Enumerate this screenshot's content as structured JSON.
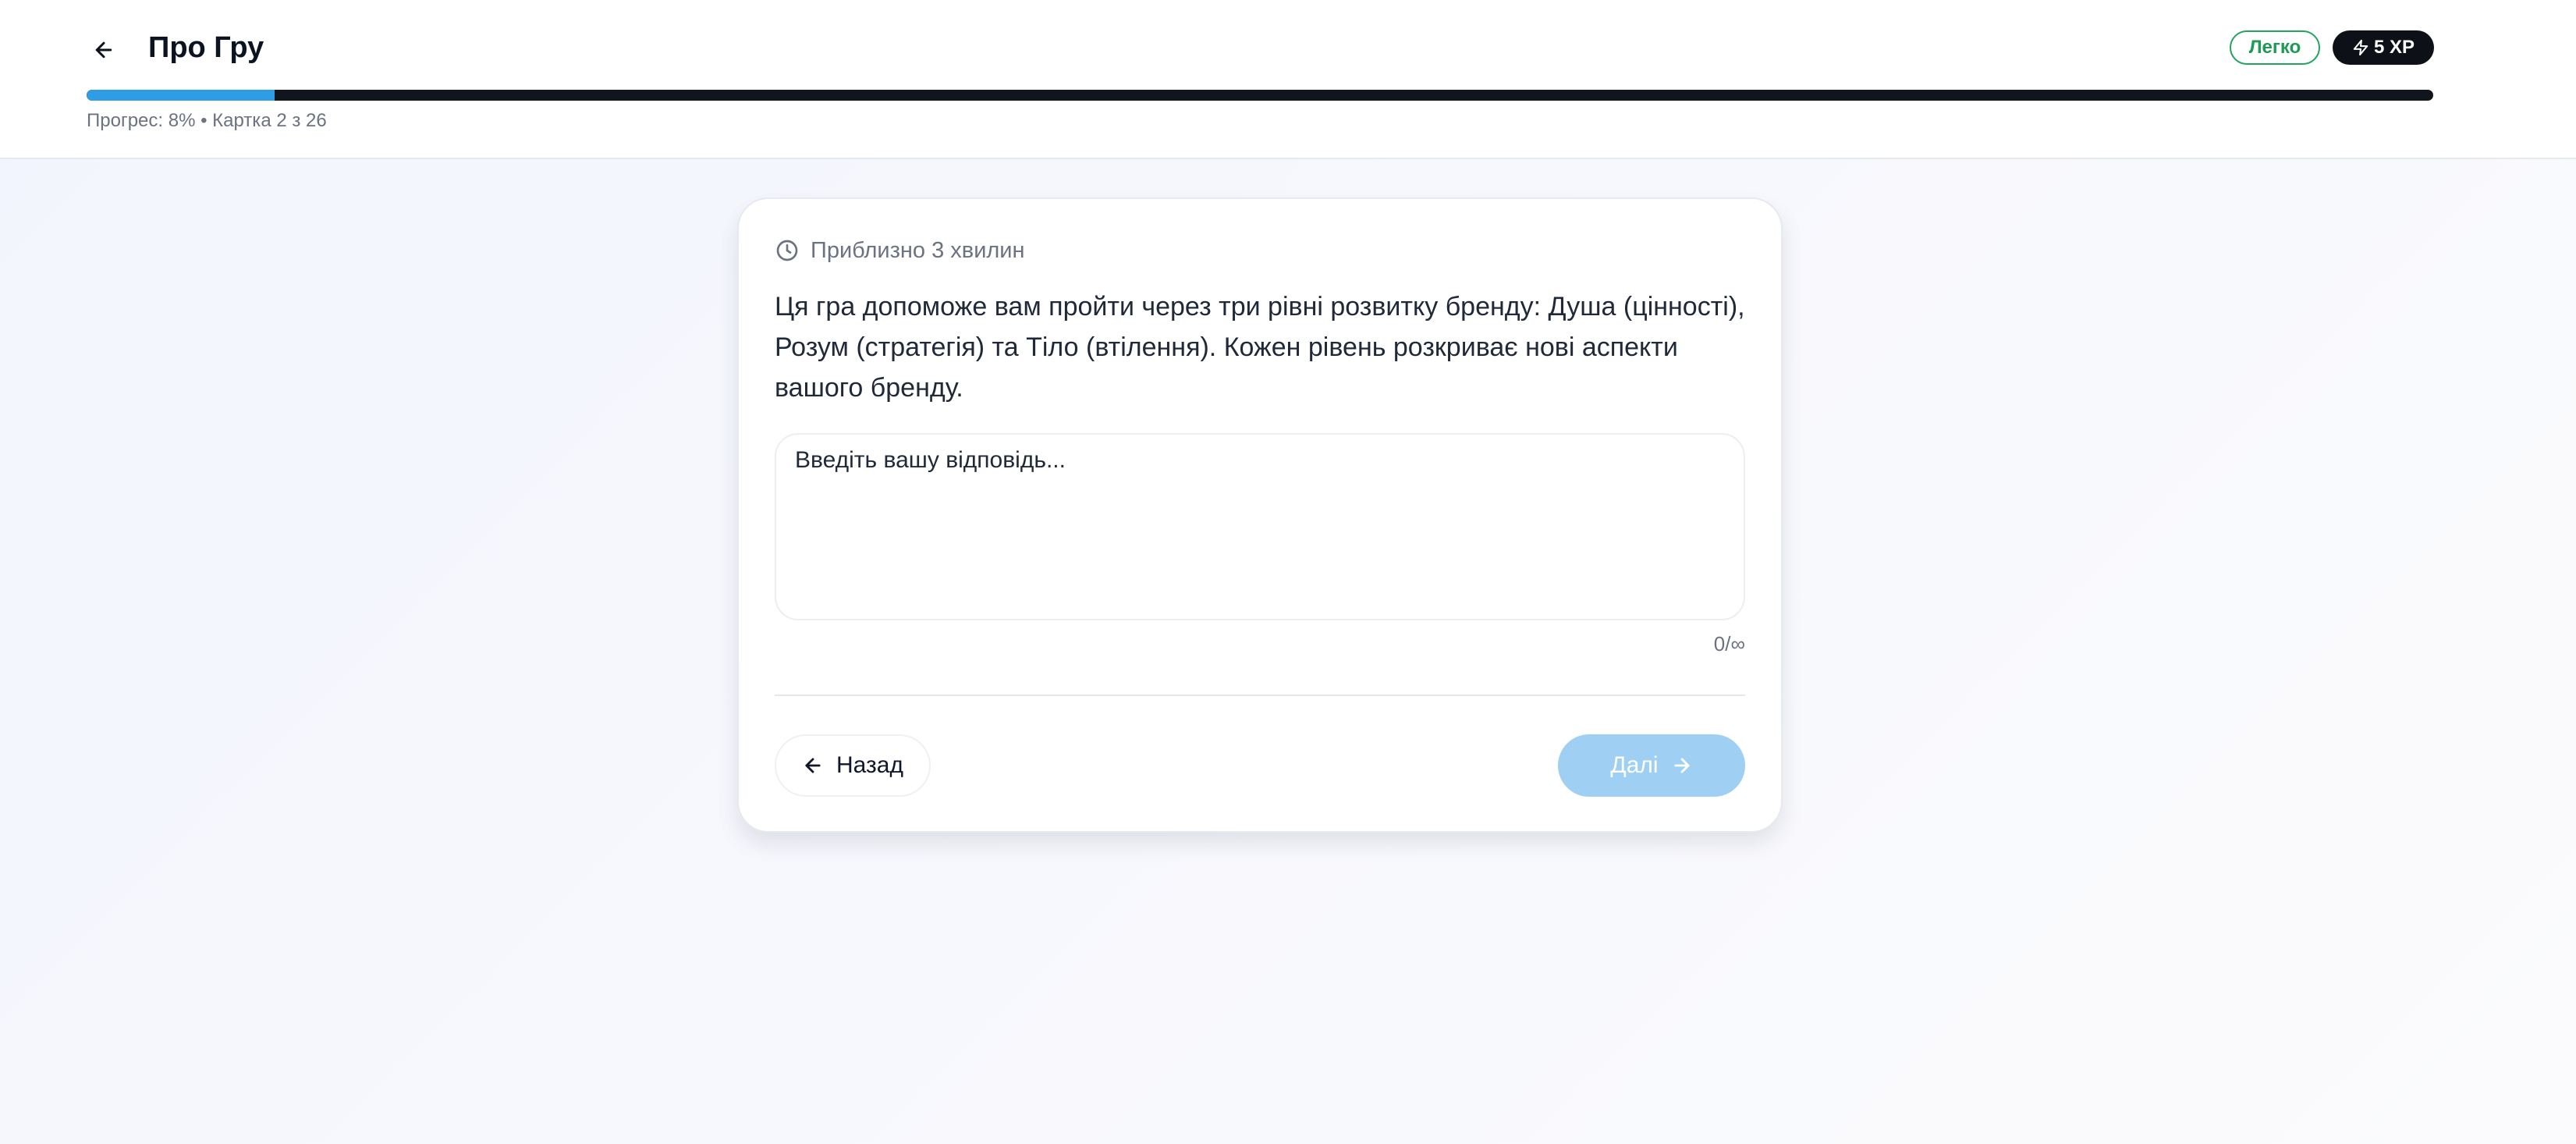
{
  "header": {
    "title": "Про Гру",
    "difficulty_badge": "Легко",
    "xp_badge": "5 XP",
    "progress_percent": 8,
    "progress_text": "Прогрес: 8% • Картка 2 з 26"
  },
  "card": {
    "duration_label": "Приблизно 3 хвилин",
    "description": "Ця гра допоможе вам пройти через три рівні розвитку бренду: Душа (цінності), Розум (стратегія) та Тіло (втілення). Кожен рівень розкриває нові аспекти вашого бренду.",
    "answer_value": "",
    "answer_placeholder": "Введіть вашу відповідь...",
    "char_count": "0/∞",
    "back_label": "Назад",
    "next_label": "Далі"
  },
  "colors": {
    "accent": "#2f9de6",
    "progress_track": "#11161d",
    "next_button_disabled": "#9fd0f3",
    "easy_badge": "#22a45d",
    "xp_badge_bg": "#0d1117"
  },
  "icons": {
    "back": "arrow-left-icon",
    "clock": "clock-icon",
    "xp": "lightning-icon",
    "next": "arrow-right-icon"
  }
}
